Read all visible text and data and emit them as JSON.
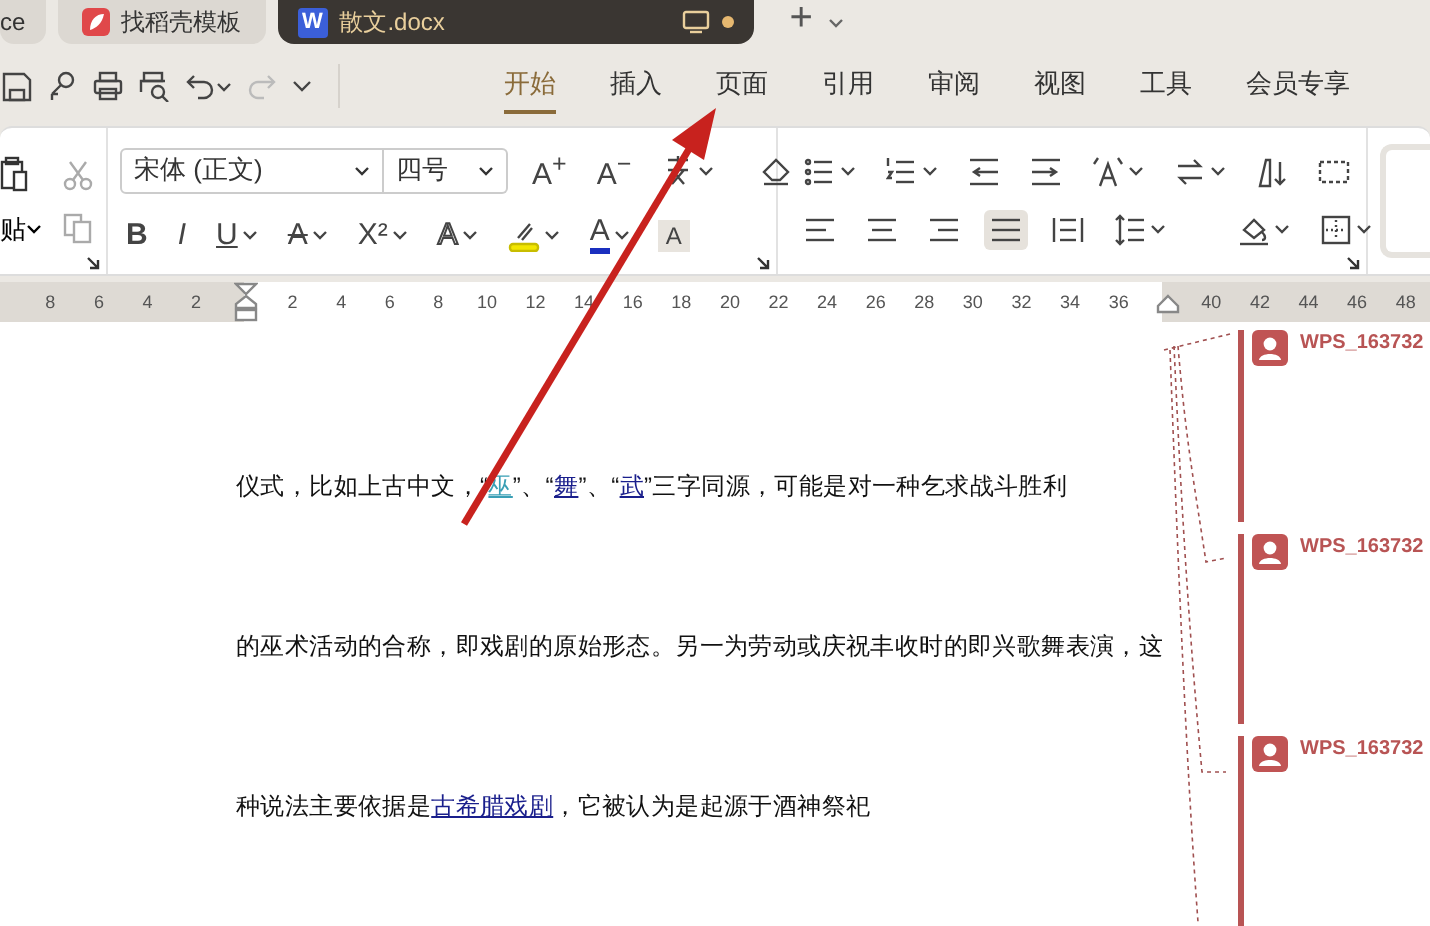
{
  "tabs": [
    {
      "kind": "plain",
      "label": "ce",
      "selected": false,
      "modified": false
    },
    {
      "kind": "docer",
      "label": "找稻壳模板",
      "selected": false,
      "modified": false
    },
    {
      "kind": "word",
      "badge": "W",
      "label": "散文.docx",
      "selected": true,
      "modified": true
    }
  ],
  "new_tab": {
    "label": "+"
  },
  "quick_access": [
    {
      "kind": "save",
      "disabled": false
    },
    {
      "kind": "painter",
      "disabled": false
    },
    {
      "kind": "print",
      "disabled": false
    },
    {
      "kind": "preview",
      "disabled": false
    },
    {
      "kind": "undo",
      "disabled": false
    },
    {
      "kind": "redo",
      "disabled": true
    },
    {
      "kind": "more",
      "disabled": false
    }
  ],
  "menu": [
    {
      "label": "开始",
      "selected": true
    },
    {
      "label": "插入",
      "selected": false
    },
    {
      "label": "页面",
      "selected": false
    },
    {
      "label": "引用",
      "selected": false
    },
    {
      "label": "审阅",
      "selected": false
    },
    {
      "label": "视图",
      "selected": false
    },
    {
      "label": "工具",
      "selected": false
    },
    {
      "label": "会员专享",
      "selected": false
    }
  ],
  "ribbon": {
    "paste_label": "贴",
    "font_family": "宋体 (正文)",
    "font_size": "四号",
    "font_row1": [
      {
        "kind": "grow",
        "label": "A$^{+}$"
      },
      {
        "kind": "shrink",
        "label": "A$^{−}$"
      },
      {
        "kind": "phonetic"
      }
    ],
    "font_row2": [
      {
        "kind": "bold",
        "label": "B"
      },
      {
        "kind": "italic",
        "label": "I"
      },
      {
        "kind": "underline",
        "label": "U"
      },
      {
        "kind": "strike",
        "label": "A"
      },
      {
        "kind": "superscript",
        "label": "X²"
      },
      {
        "kind": "outline",
        "label": "A"
      },
      {
        "kind": "highlight"
      },
      {
        "kind": "fontcolor",
        "label": "A"
      }
    ],
    "clear_format": {
      "label": "A"
    },
    "alignment": [
      {
        "kind": "left",
        "selected": false
      },
      {
        "kind": "center",
        "selected": false
      },
      {
        "kind": "right",
        "selected": false
      },
      {
        "kind": "justify",
        "selected": true
      },
      {
        "kind": "distributed",
        "selected": false
      }
    ]
  },
  "ruler": {
    "left_ticks": [
      "8",
      "6",
      "4",
      "2"
    ],
    "body_ticks": [
      "2",
      "4",
      "6",
      "8",
      "10",
      "12",
      "14",
      "16",
      "18",
      "20",
      "22",
      "24",
      "26",
      "28",
      "30",
      "32",
      "34",
      "36"
    ],
    "right_ticks": [
      "40",
      "42",
      "44",
      "46",
      "48"
    ]
  },
  "document": {
    "lines": [
      {
        "segments": [
          {
            "text": "仪式，比如上古中文，“",
            "link": false
          },
          {
            "text": "巫",
            "link": true,
            "color": "#3a9fb5"
          },
          {
            "text": "”、“",
            "link": false
          },
          {
            "text": "舞",
            "link": true,
            "color": "#1a1f8c"
          },
          {
            "text": "”、“",
            "link": false
          },
          {
            "text": "武",
            "link": true,
            "color": "#1a1f8c"
          },
          {
            "text": "”三字同源，可能是对一种乞求战斗胜利",
            "link": false
          }
        ]
      },
      {
        "segments": [
          {
            "text": "的巫术活动的合称，即戏剧的原始形态。另一为劳动或庆祝丰收时的即兴歌舞表演，这",
            "link": false
          }
        ]
      },
      {
        "segments": [
          {
            "text": "种说法主要依据是",
            "link": false
          },
          {
            "text": "古希腊戏剧",
            "link": true,
            "color": "#1a1f8c"
          },
          {
            "text": "，它被认为是起源于酒神祭祀",
            "link": false
          }
        ]
      }
    ]
  },
  "comments": [
    {
      "author": "WPS_163732"
    },
    {
      "author": "WPS_163732"
    },
    {
      "author": "WPS_163732"
    }
  ]
}
